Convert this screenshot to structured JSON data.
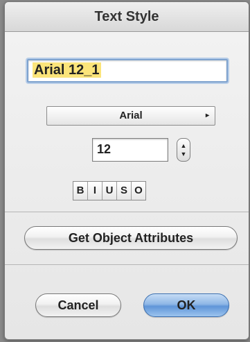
{
  "window": {
    "title": "Text Style"
  },
  "name_field": {
    "value": "Arial 12_1"
  },
  "font_popup": {
    "label": "Arial",
    "arrow": "▸"
  },
  "size": {
    "value": "12",
    "stepper_up": "▲",
    "stepper_down": "▼"
  },
  "style_buttons": [
    "B",
    "I",
    "U",
    "S",
    "O"
  ],
  "get_attributes_button": "Get Object Attributes",
  "cancel_button": "Cancel",
  "ok_button": "OK",
  "colors": {
    "selection_highlight": "#fbe47a",
    "default_button": "#5f95d8",
    "focus_ring": "#7da2ce"
  }
}
